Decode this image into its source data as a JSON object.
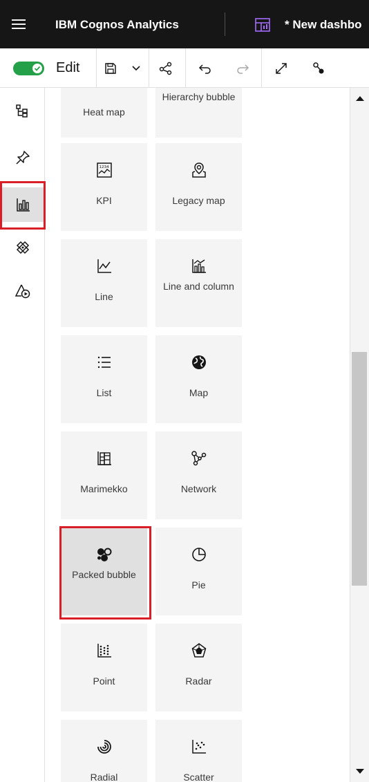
{
  "header": {
    "app_title": "IBM Cognos Analytics",
    "dashboard_title": "* New dashbo"
  },
  "toolbar": {
    "edit_label": "Edit",
    "edit_enabled": true,
    "toggle_color": "#24a148"
  },
  "rail": {
    "items": [
      "data-sources-icon",
      "pin-icon",
      "visualizations-icon",
      "widgets-icon",
      "assistant-icon"
    ],
    "active": "visualizations-icon"
  },
  "visualizations": {
    "tiles": [
      {
        "label": "Heat map",
        "icon": "heat-map-icon"
      },
      {
        "label": "Hierarchy bubble",
        "icon": "hierarchy-bubble-icon"
      },
      {
        "label": "KPI",
        "icon": "kpi-icon"
      },
      {
        "label": "Legacy map",
        "icon": "legacy-map-icon"
      },
      {
        "label": "Line",
        "icon": "line-chart-icon"
      },
      {
        "label": "Line and column",
        "icon": "line-and-column-icon"
      },
      {
        "label": "List",
        "icon": "list-icon"
      },
      {
        "label": "Map",
        "icon": "map-globe-icon"
      },
      {
        "label": "Marimekko",
        "icon": "marimekko-icon"
      },
      {
        "label": "Network",
        "icon": "network-icon"
      },
      {
        "label": "Packed bubble",
        "icon": "packed-bubble-icon"
      },
      {
        "label": "Pie",
        "icon": "pie-icon"
      },
      {
        "label": "Point",
        "icon": "point-icon"
      },
      {
        "label": "Radar",
        "icon": "radar-icon"
      },
      {
        "label": "Radial",
        "icon": "radial-icon"
      },
      {
        "label": "Scatter",
        "icon": "scatter-icon"
      }
    ],
    "selected": "Packed bubble"
  },
  "colors": {
    "header_bg": "#161616",
    "accent": "#0f62fe",
    "highlight": "#da1e28",
    "tile_bg": "#f4f4f4"
  }
}
